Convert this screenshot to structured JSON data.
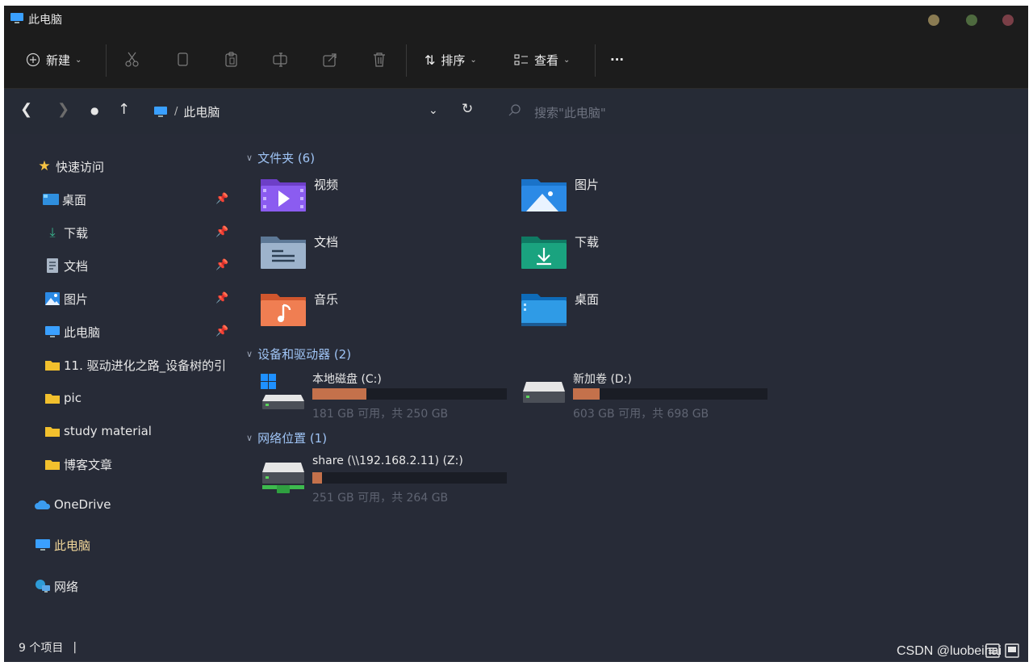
{
  "window": {
    "title": "此电脑"
  },
  "toolbar": {
    "new_label": "新建",
    "sort_label": "排序",
    "view_label": "查看",
    "more_label": "···"
  },
  "address": {
    "breadcrumb": "此电脑",
    "search_placeholder": "搜索\"此电脑\""
  },
  "sidebar": {
    "quick_access": "快速访问",
    "items": [
      {
        "label": "桌面",
        "icon": "desktop-icon",
        "pinned": true
      },
      {
        "label": "下载",
        "icon": "download-icon",
        "pinned": true
      },
      {
        "label": "文档",
        "icon": "document-icon",
        "pinned": true
      },
      {
        "label": "图片",
        "icon": "picture-icon",
        "pinned": true
      },
      {
        "label": "此电脑",
        "icon": "computer-icon",
        "pinned": true
      },
      {
        "label": "11. 驱动进化之路_设备树的引",
        "icon": "folder-icon",
        "pinned": false
      },
      {
        "label": "pic",
        "icon": "folder-icon",
        "pinned": false
      },
      {
        "label": "study material",
        "icon": "folder-icon",
        "pinned": false
      },
      {
        "label": "博客文章",
        "icon": "folder-icon",
        "pinned": false
      }
    ],
    "onedrive": "OneDrive",
    "this_pc": "此电脑",
    "network": "网络"
  },
  "content": {
    "folders_header": "文件夹 (6)",
    "folders": [
      {
        "name": "视频",
        "icon": "videos-folder-icon"
      },
      {
        "name": "图片",
        "icon": "pictures-folder-icon"
      },
      {
        "name": "文档",
        "icon": "documents-folder-icon"
      },
      {
        "name": "下载",
        "icon": "downloads-folder-icon"
      },
      {
        "name": "音乐",
        "icon": "music-folder-icon"
      },
      {
        "name": "桌面",
        "icon": "desktop-folder-icon"
      }
    ],
    "devices_header": "设备和驱动器 (2)",
    "drives": [
      {
        "name": "本地磁盘 (C:)",
        "size": "181 GB 可用，共 250 GB",
        "used_fraction": 0.276
      },
      {
        "name": "新加卷 (D:)",
        "size": "603 GB 可用，共 698 GB",
        "used_fraction": 0.136
      }
    ],
    "network_header": "网络位置 (1)",
    "network_drives": [
      {
        "name": "share (\\\\192.168.2.11) (Z:)",
        "size": "251 GB 可用，共 264 GB",
        "used_fraction": 0.049
      }
    ]
  },
  "status": {
    "items_count": "9 个项目"
  },
  "watermark": "CSDN @luobeihai",
  "colors": {
    "accent": "#9fc4f5",
    "drive_fill": "#c4714b",
    "window_bg": "#202020",
    "pane_bg": "#272b37"
  }
}
